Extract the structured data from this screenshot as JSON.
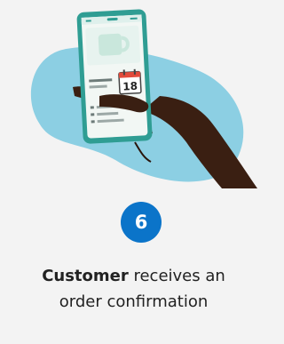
{
  "step": {
    "number": "6",
    "color": "#0b74c9"
  },
  "caption": {
    "bold": "Customer",
    "line1_rest": " receives an",
    "line2": "order confirmation"
  },
  "illustration": {
    "calendar_day": "18",
    "icons": [
      "phone-icon",
      "hand-icon",
      "mug-icon",
      "calendar-icon"
    ],
    "colors": {
      "blob": "#8ccfe3",
      "hand": "#3a1f12",
      "phone_frame": "#2f9d93",
      "screen": "#f2f7f4",
      "mug": "#c9e7dc"
    }
  }
}
